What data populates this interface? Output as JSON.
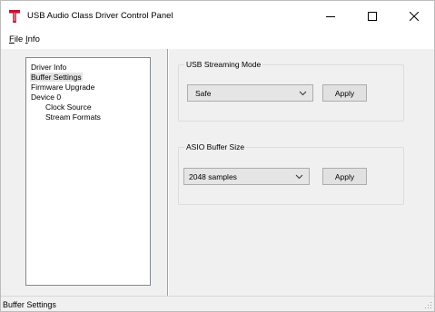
{
  "window": {
    "title": "USB Audio Class Driver Control Panel",
    "icon": "t-logo-icon",
    "brand_color": "#c8102e"
  },
  "titlebar_buttons": {
    "minimize": "minimize-icon",
    "maximize": "maximize-icon",
    "close": "close-icon"
  },
  "menu": {
    "file_mnemonic": "F",
    "file_rest": "ile",
    "info_mnemonic": "I",
    "info_rest": "nfo"
  },
  "tree": {
    "items": [
      {
        "label": "Driver Info",
        "selected": false
      },
      {
        "label": "Buffer Settings",
        "selected": true
      },
      {
        "label": "Firmware Upgrade",
        "selected": false
      },
      {
        "label": "Device 0",
        "selected": false
      },
      {
        "label": "Clock Source",
        "selected": false
      },
      {
        "label": "Stream Formats",
        "selected": false
      }
    ]
  },
  "usb_streaming": {
    "title": "USB Streaming Mode",
    "value": "Safe",
    "apply_label": "Apply"
  },
  "asio_buffer": {
    "title": "ASIO Buffer Size",
    "value": "2048 samples",
    "apply_label": "Apply"
  },
  "status": {
    "text": "Buffer Settings"
  }
}
